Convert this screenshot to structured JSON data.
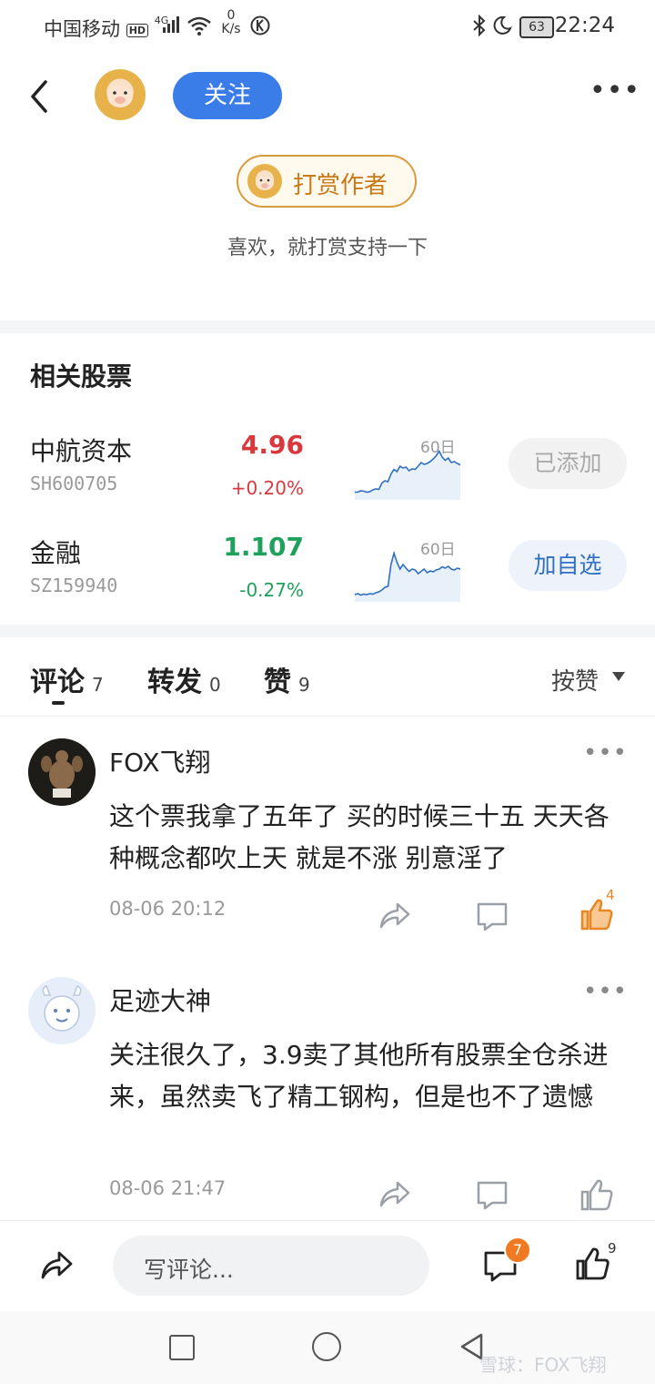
{
  "status_bar": {
    "carrier": "中国移动",
    "hd": "HD",
    "net": "4G",
    "speed_value": "0",
    "speed_unit": "K/s",
    "battery": "63",
    "time": "22:24"
  },
  "header": {
    "follow_label": "关注",
    "more_label": "•••"
  },
  "tip": {
    "label": "打赏作者",
    "subtitle": "喜欢，就打赏支持一下"
  },
  "related_stocks": {
    "title": "相关股票",
    "period_label": "60日",
    "items": [
      {
        "name": "中航资本",
        "code": "SH600705",
        "price": "4.96",
        "change": "+0.20%",
        "button": "已添加",
        "status": "up",
        "spark": [
          0.05,
          0.05,
          0.08,
          0.07,
          0.05,
          0.06,
          0.1,
          0.12,
          0.11,
          0.25,
          0.3,
          0.28,
          0.45,
          0.55,
          0.5,
          0.62,
          0.58,
          0.6,
          0.52,
          0.56,
          0.55,
          0.62,
          0.7,
          0.66,
          0.68,
          0.72,
          0.78,
          0.85,
          0.95,
          0.82,
          0.75,
          0.8,
          0.7,
          0.72,
          0.68,
          0.65
        ]
      },
      {
        "name": "金融",
        "code": "SZ159940",
        "price": "1.107",
        "change": "-0.27%",
        "button": "加自选",
        "status": "down",
        "spark": [
          0.04,
          0.06,
          0.03,
          0.05,
          0.04,
          0.06,
          0.05,
          0.08,
          0.1,
          0.14,
          0.2,
          0.22,
          0.7,
          0.95,
          0.75,
          0.6,
          0.7,
          0.62,
          0.55,
          0.6,
          0.58,
          0.5,
          0.55,
          0.6,
          0.52,
          0.56,
          0.54,
          0.58,
          0.6,
          0.65,
          0.62,
          0.66,
          0.6,
          0.58,
          0.62,
          0.6
        ]
      }
    ]
  },
  "tabs": [
    {
      "label": "评论",
      "count": "7"
    },
    {
      "label": "转发",
      "count": "0"
    },
    {
      "label": "赞",
      "count": "9"
    }
  ],
  "sort_label": "按赞",
  "comments": [
    {
      "name": "FOX飞翔",
      "text": "这个票我拿了五年了 买的时候三十五 天天各种概念都吹上天 就是不涨 别意淫了",
      "time": "08-06 20:12",
      "likes": "4"
    },
    {
      "name": "足迹大神",
      "text": "关注很久了，3.9卖了其他所有股票全仓杀进来，虽然卖飞了精工钢构，但是也不了遗憾",
      "time": "08-06 21:47",
      "likes": ""
    }
  ],
  "bottom_bar": {
    "input_placeholder": "写评论...",
    "comment_badge": "7",
    "like_count": "9"
  },
  "watermark": "雪球：FOX飞翔",
  "colors": {
    "accent": "#3b7de8",
    "up": "#d9393e",
    "down": "#1fa05c",
    "tip": "#c97a18"
  }
}
